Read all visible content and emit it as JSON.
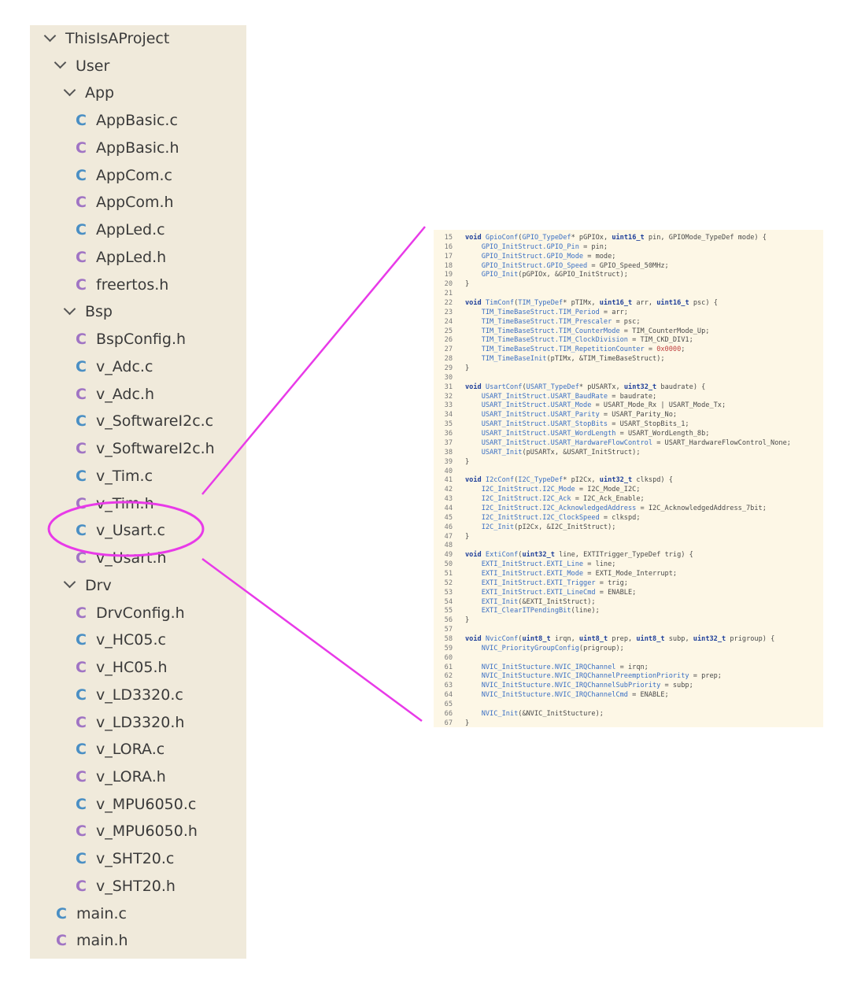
{
  "tree": {
    "items": [
      {
        "label": "ThisIsAProject",
        "kind": "folder"
      },
      {
        "label": "User",
        "kind": "folder"
      },
      {
        "label": "App",
        "kind": "folder"
      },
      {
        "label": "AppBasic.c",
        "kind": "c"
      },
      {
        "label": "AppBasic.h",
        "kind": "h"
      },
      {
        "label": "AppCom.c",
        "kind": "c"
      },
      {
        "label": "AppCom.h",
        "kind": "h"
      },
      {
        "label": "AppLed.c",
        "kind": "c"
      },
      {
        "label": "AppLed.h",
        "kind": "h"
      },
      {
        "label": "freertos.h",
        "kind": "h"
      },
      {
        "label": "Bsp",
        "kind": "folder"
      },
      {
        "label": "BspConfig.h",
        "kind": "h"
      },
      {
        "label": "v_Adc.c",
        "kind": "c"
      },
      {
        "label": "v_Adc.h",
        "kind": "h"
      },
      {
        "label": "v_SoftwareI2c.c",
        "kind": "c"
      },
      {
        "label": "v_SoftwareI2c.h",
        "kind": "h"
      },
      {
        "label": "v_Tim.c",
        "kind": "c"
      },
      {
        "label": "v_Tim.h",
        "kind": "h"
      },
      {
        "label": "v_Usart.c",
        "kind": "c"
      },
      {
        "label": "v_Usart.h",
        "kind": "h"
      },
      {
        "label": "Drv",
        "kind": "folder"
      },
      {
        "label": "DrvConfig.h",
        "kind": "h"
      },
      {
        "label": "v_HC05.c",
        "kind": "c"
      },
      {
        "label": "v_HC05.h",
        "kind": "h"
      },
      {
        "label": "v_LD3320.c",
        "kind": "c"
      },
      {
        "label": "v_LD3320.h",
        "kind": "h"
      },
      {
        "label": "v_LORA.c",
        "kind": "c"
      },
      {
        "label": "v_LORA.h",
        "kind": "h"
      },
      {
        "label": "v_MPU6050.c",
        "kind": "c"
      },
      {
        "label": "v_MPU6050.h",
        "kind": "h"
      },
      {
        "label": "v_SHT20.c",
        "kind": "c"
      },
      {
        "label": "v_SHT20.h",
        "kind": "h"
      },
      {
        "label": "main.c",
        "kind": "c"
      },
      {
        "label": "main.h",
        "kind": "h"
      }
    ],
    "file_icon_glyph": "C",
    "highlighted_label": "v_Usart.c"
  },
  "colors": {
    "tree_bg": "#f0eadb",
    "code_bg": "#fdf7e6",
    "c_icon": "#4a8fc4",
    "h_icon": "#a074c4",
    "keyword": "#1f3f9a",
    "identifier": "#3a6fc4",
    "number": "#c04040",
    "annotation": "#e83ae8"
  },
  "code": {
    "lines": [
      {
        "n": "15",
        "segs": [
          [
            "kw",
            "void"
          ],
          [
            "t",
            " "
          ],
          [
            "fn",
            "GpioConf"
          ],
          [
            "t",
            "("
          ],
          [
            "fn",
            "GPIO_TypeDef"
          ],
          [
            "t",
            "* pGPIOx, "
          ],
          [
            "kw",
            "uint16_t"
          ],
          [
            "t",
            " pin, GPIOMode_TypeDef mode) {"
          ]
        ]
      },
      {
        "n": "16",
        "segs": [
          [
            "t",
            "    "
          ],
          [
            "mb",
            "GPIO_InitStruct.GPIO_Pin"
          ],
          [
            "t",
            " = pin;"
          ]
        ]
      },
      {
        "n": "17",
        "segs": [
          [
            "t",
            "    "
          ],
          [
            "mb",
            "GPIO_InitStruct.GPIO_Mode"
          ],
          [
            "t",
            " = mode;"
          ]
        ]
      },
      {
        "n": "18",
        "segs": [
          [
            "t",
            "    "
          ],
          [
            "mb",
            "GPIO_InitStruct.GPIO_Speed"
          ],
          [
            "t",
            " = GPIO_Speed_50MHz;"
          ]
        ]
      },
      {
        "n": "19",
        "segs": [
          [
            "t",
            "    "
          ],
          [
            "mb",
            "GPIO_Init"
          ],
          [
            "t",
            "(pGPIOx, &GPIO_InitStruct);"
          ]
        ]
      },
      {
        "n": "20",
        "segs": [
          [
            "t",
            "}"
          ]
        ]
      },
      {
        "n": "21",
        "segs": []
      },
      {
        "n": "22",
        "segs": [
          [
            "kw",
            "void"
          ],
          [
            "t",
            " "
          ],
          [
            "fn",
            "TimConf"
          ],
          [
            "t",
            "("
          ],
          [
            "fn",
            "TIM_TypeDef"
          ],
          [
            "t",
            "* pTIMx, "
          ],
          [
            "kw",
            "uint16_t"
          ],
          [
            "t",
            " arr, "
          ],
          [
            "kw",
            "uint16_t"
          ],
          [
            "t",
            " psc) {"
          ]
        ]
      },
      {
        "n": "23",
        "segs": [
          [
            "t",
            "    "
          ],
          [
            "mb",
            "TIM_TimeBaseStruct.TIM_Period"
          ],
          [
            "t",
            " = arr;"
          ]
        ]
      },
      {
        "n": "24",
        "segs": [
          [
            "t",
            "    "
          ],
          [
            "mb",
            "TIM_TimeBaseStruct.TIM_Prescaler"
          ],
          [
            "t",
            " = psc;"
          ]
        ]
      },
      {
        "n": "25",
        "segs": [
          [
            "t",
            "    "
          ],
          [
            "mb",
            "TIM_TimeBaseStruct.TIM_CounterMode"
          ],
          [
            "t",
            " = TIM_CounterMode_Up;"
          ]
        ]
      },
      {
        "n": "26",
        "segs": [
          [
            "t",
            "    "
          ],
          [
            "mb",
            "TIM_TimeBaseStruct.TIM_ClockDivision"
          ],
          [
            "t",
            " = TIM_CKD_DIV1;"
          ]
        ]
      },
      {
        "n": "27",
        "segs": [
          [
            "t",
            "    "
          ],
          [
            "mb",
            "TIM_TimeBaseStruct.TIM_RepetitionCounter"
          ],
          [
            "t",
            " = "
          ],
          [
            "num",
            "0x0000"
          ],
          [
            "t",
            ";"
          ]
        ]
      },
      {
        "n": "28",
        "segs": [
          [
            "t",
            "    "
          ],
          [
            "mb",
            "TIM_TimeBaseInit"
          ],
          [
            "t",
            "(pTIMx, &TIM_TimeBaseStruct);"
          ]
        ]
      },
      {
        "n": "29",
        "segs": [
          [
            "t",
            "}"
          ]
        ]
      },
      {
        "n": "30",
        "segs": []
      },
      {
        "n": "31",
        "segs": [
          [
            "kw",
            "void"
          ],
          [
            "t",
            " "
          ],
          [
            "fn",
            "UsartConf"
          ],
          [
            "t",
            "("
          ],
          [
            "fn",
            "USART_TypeDef"
          ],
          [
            "t",
            "* pUSARTx, "
          ],
          [
            "kw",
            "uint32_t"
          ],
          [
            "t",
            " baudrate) {"
          ]
        ]
      },
      {
        "n": "32",
        "segs": [
          [
            "t",
            "    "
          ],
          [
            "mb",
            "USART_InitStruct.USART_BaudRate"
          ],
          [
            "t",
            " = baudrate;"
          ]
        ]
      },
      {
        "n": "33",
        "segs": [
          [
            "t",
            "    "
          ],
          [
            "mb",
            "USART_InitStruct.USART_Mode"
          ],
          [
            "t",
            " = USART_Mode_Rx | USART_Mode_Tx;"
          ]
        ]
      },
      {
        "n": "34",
        "segs": [
          [
            "t",
            "    "
          ],
          [
            "mb",
            "USART_InitStruct.USART_Parity"
          ],
          [
            "t",
            " = USART_Parity_No;"
          ]
        ]
      },
      {
        "n": "35",
        "segs": [
          [
            "t",
            "    "
          ],
          [
            "mb",
            "USART_InitStruct.USART_StopBits"
          ],
          [
            "t",
            " = USART_StopBits_1;"
          ]
        ]
      },
      {
        "n": "36",
        "segs": [
          [
            "t",
            "    "
          ],
          [
            "mb",
            "USART_InitStruct.USART_WordLength"
          ],
          [
            "t",
            " = USART_WordLength_8b;"
          ]
        ]
      },
      {
        "n": "37",
        "segs": [
          [
            "t",
            "    "
          ],
          [
            "mb",
            "USART_InitStruct.USART_HardwareFlowControl"
          ],
          [
            "t",
            " = USART_HardwareFlowControl_None;"
          ]
        ]
      },
      {
        "n": "38",
        "segs": [
          [
            "t",
            "    "
          ],
          [
            "mb",
            "USART_Init"
          ],
          [
            "t",
            "(pUSARTx, &USART_InitStruct);"
          ]
        ]
      },
      {
        "n": "39",
        "segs": [
          [
            "t",
            "}"
          ]
        ]
      },
      {
        "n": "40",
        "segs": []
      },
      {
        "n": "41",
        "segs": [
          [
            "kw",
            "void"
          ],
          [
            "t",
            " "
          ],
          [
            "fn",
            "I2cConf"
          ],
          [
            "t",
            "("
          ],
          [
            "fn",
            "I2C_TypeDef"
          ],
          [
            "t",
            "* pI2Cx, "
          ],
          [
            "kw",
            "uint32_t"
          ],
          [
            "t",
            " clkspd) {"
          ]
        ]
      },
      {
        "n": "42",
        "segs": [
          [
            "t",
            "    "
          ],
          [
            "mb",
            "I2C_InitStruct.I2C_Mode"
          ],
          [
            "t",
            " = I2C_Mode_I2C;"
          ]
        ]
      },
      {
        "n": "43",
        "segs": [
          [
            "t",
            "    "
          ],
          [
            "mb",
            "I2C_InitStruct.I2C_Ack"
          ],
          [
            "t",
            " = I2C_Ack_Enable;"
          ]
        ]
      },
      {
        "n": "44",
        "segs": [
          [
            "t",
            "    "
          ],
          [
            "mb",
            "I2C_InitStruct.I2C_AcknowledgedAddress"
          ],
          [
            "t",
            " = I2C_AcknowledgedAddress_7bit;"
          ]
        ]
      },
      {
        "n": "45",
        "segs": [
          [
            "t",
            "    "
          ],
          [
            "mb",
            "I2C_InitStruct.I2C_ClockSpeed"
          ],
          [
            "t",
            " = clkspd;"
          ]
        ]
      },
      {
        "n": "46",
        "segs": [
          [
            "t",
            "    "
          ],
          [
            "mb",
            "I2C_Init"
          ],
          [
            "t",
            "(pI2Cx, &I2C_InitStruct);"
          ]
        ]
      },
      {
        "n": "47",
        "segs": [
          [
            "t",
            "}"
          ]
        ]
      },
      {
        "n": "48",
        "segs": []
      },
      {
        "n": "49",
        "segs": [
          [
            "kw",
            "void"
          ],
          [
            "t",
            " "
          ],
          [
            "fn",
            "ExtiConf"
          ],
          [
            "t",
            "("
          ],
          [
            "kw",
            "uint32_t"
          ],
          [
            "t",
            " line, EXTITrigger_TypeDef trig) {"
          ]
        ]
      },
      {
        "n": "50",
        "segs": [
          [
            "t",
            "    "
          ],
          [
            "mb",
            "EXTI_InitStruct.EXTI_Line"
          ],
          [
            "t",
            " = line;"
          ]
        ]
      },
      {
        "n": "51",
        "segs": [
          [
            "t",
            "    "
          ],
          [
            "mb",
            "EXTI_InitStruct.EXTI_Mode"
          ],
          [
            "t",
            " = EXTI_Mode_Interrupt;"
          ]
        ]
      },
      {
        "n": "52",
        "segs": [
          [
            "t",
            "    "
          ],
          [
            "mb",
            "EXTI_InitStruct.EXTI_Trigger"
          ],
          [
            "t",
            " = trig;"
          ]
        ]
      },
      {
        "n": "53",
        "segs": [
          [
            "t",
            "    "
          ],
          [
            "mb",
            "EXTI_InitStruct.EXTI_LineCmd"
          ],
          [
            "t",
            " = ENABLE;"
          ]
        ]
      },
      {
        "n": "54",
        "segs": [
          [
            "t",
            "    "
          ],
          [
            "mb",
            "EXTI_Init"
          ],
          [
            "t",
            "(&EXTI_InitStruct);"
          ]
        ]
      },
      {
        "n": "55",
        "segs": [
          [
            "t",
            "    "
          ],
          [
            "mb",
            "EXTI_ClearITPendingBit"
          ],
          [
            "t",
            "(line);"
          ]
        ]
      },
      {
        "n": "56",
        "segs": [
          [
            "t",
            "}"
          ]
        ]
      },
      {
        "n": "57",
        "segs": []
      },
      {
        "n": "58",
        "segs": [
          [
            "kw",
            "void"
          ],
          [
            "t",
            " "
          ],
          [
            "fn",
            "NvicConf"
          ],
          [
            "t",
            "("
          ],
          [
            "kw",
            "uint8_t"
          ],
          [
            "t",
            " irqn, "
          ],
          [
            "kw",
            "uint8_t"
          ],
          [
            "t",
            " prep, "
          ],
          [
            "kw",
            "uint8_t"
          ],
          [
            "t",
            " subp, "
          ],
          [
            "kw",
            "uint32_t"
          ],
          [
            "t",
            " prigroup) {"
          ]
        ]
      },
      {
        "n": "59",
        "segs": [
          [
            "t",
            "    "
          ],
          [
            "mb",
            "NVIC_PriorityGroupConfig"
          ],
          [
            "t",
            "(prigroup);"
          ]
        ]
      },
      {
        "n": "60",
        "segs": []
      },
      {
        "n": "61",
        "segs": [
          [
            "t",
            "    "
          ],
          [
            "mb",
            "NVIC_InitStucture.NVIC_IRQChannel"
          ],
          [
            "t",
            " = irqn;"
          ]
        ]
      },
      {
        "n": "62",
        "segs": [
          [
            "t",
            "    "
          ],
          [
            "mb",
            "NVIC_InitStucture.NVIC_IRQChannelPreemptionPriority"
          ],
          [
            "t",
            " = prep;"
          ]
        ]
      },
      {
        "n": "63",
        "segs": [
          [
            "t",
            "    "
          ],
          [
            "mb",
            "NVIC_InitStucture.NVIC_IRQChannelSubPriority"
          ],
          [
            "t",
            " = subp;"
          ]
        ]
      },
      {
        "n": "64",
        "segs": [
          [
            "t",
            "    "
          ],
          [
            "mb",
            "NVIC_InitStucture.NVIC_IRQChannelCmd"
          ],
          [
            "t",
            " = ENABLE;"
          ]
        ]
      },
      {
        "n": "65",
        "segs": []
      },
      {
        "n": "66",
        "segs": [
          [
            "t",
            "    "
          ],
          [
            "mb",
            "NVIC_Init"
          ],
          [
            "t",
            "(&NVIC_InitStucture);"
          ]
        ]
      },
      {
        "n": "67",
        "segs": [
          [
            "t",
            "}"
          ]
        ]
      }
    ]
  }
}
